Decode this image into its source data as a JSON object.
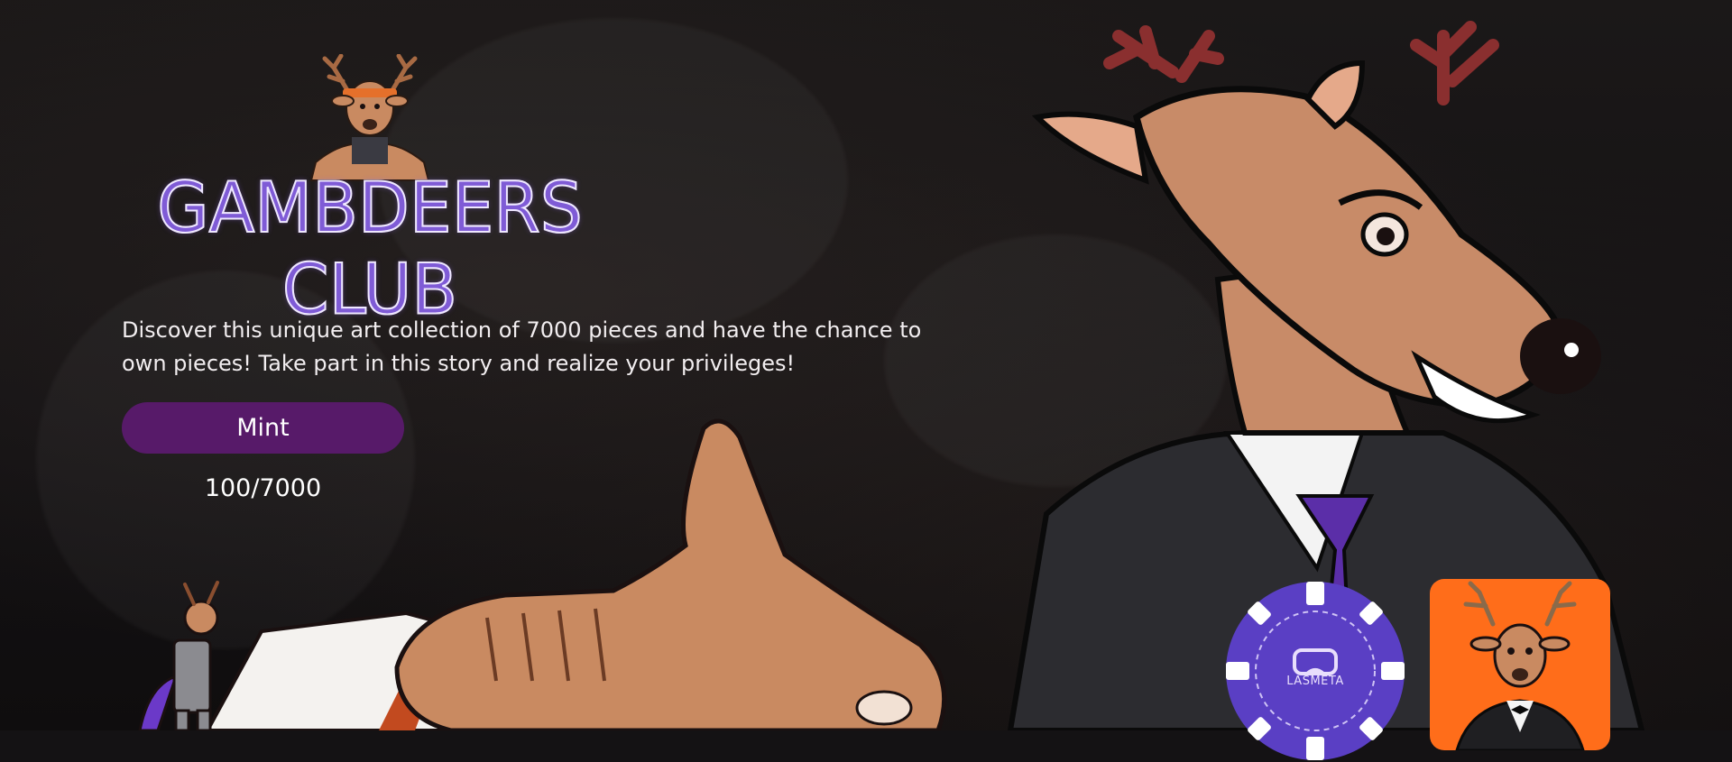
{
  "brand": {
    "name": "GAMBDEERS CLUB"
  },
  "hero": {
    "description": "Discover this unique art collection of 7000 pieces and have the chance to own pieces! Take part in this story and realize your privileges!",
    "mint_label": "Mint",
    "mint_count": "100/7000"
  },
  "chip": {
    "label": "LASMETA"
  },
  "colors": {
    "accent": "#571a69",
    "logo_purple": "#7f5bd6",
    "card_orange": "#ff6d1a",
    "chip_purple": "#5a3fc4"
  },
  "icons": [
    "deer-mascot-icon",
    "vr-headset-icon",
    "poker-chip-icon"
  ]
}
